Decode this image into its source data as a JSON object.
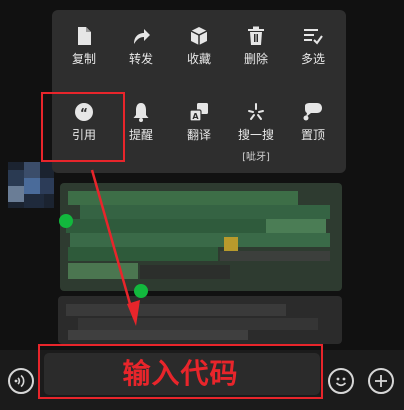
{
  "menu": {
    "row1": [
      {
        "label": "复制",
        "icon": "document-icon"
      },
      {
        "label": "转发",
        "icon": "forward-arrow-icon"
      },
      {
        "label": "收藏",
        "icon": "cube-icon"
      },
      {
        "label": "删除",
        "icon": "trash-icon"
      },
      {
        "label": "多选",
        "icon": "multi-select-list-icon"
      }
    ],
    "row2": [
      {
        "label": "引用",
        "icon": "quote-icon"
      },
      {
        "label": "提醒",
        "icon": "bell-icon"
      },
      {
        "label": "翻译",
        "icon": "translate-icon"
      },
      {
        "label": "搜一搜",
        "sublabel": "[呲牙]",
        "icon": "search-sparkle-icon"
      },
      {
        "label": "置顶",
        "icon": "pin-top-icon"
      }
    ]
  },
  "annotation": {
    "overlay_text": "输入代码",
    "color": "#e8252b"
  },
  "input_bar": {
    "voice_icon": "voice-icon",
    "emoji_icon": "emoji-icon",
    "add_icon": "add-icon"
  },
  "colors": {
    "popup_bg": "#2e2e2e",
    "selection_green": "#12b83d",
    "annotation_red": "#e8252b"
  }
}
